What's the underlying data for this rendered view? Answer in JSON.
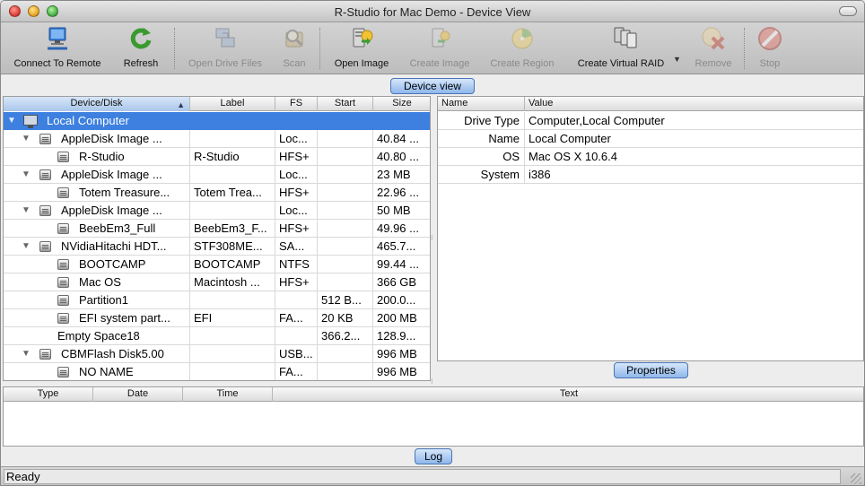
{
  "window": {
    "title": "R-Studio for Mac Demo - Device View"
  },
  "toolbar": {
    "items": [
      {
        "label": "Connect To Remote",
        "icon": "connect-remote-icon",
        "enabled": true
      },
      {
        "label": "Refresh",
        "icon": "refresh-icon",
        "enabled": true
      },
      {
        "label": "Open Drive Files",
        "icon": "open-drive-files-icon",
        "enabled": false
      },
      {
        "label": "Scan",
        "icon": "scan-icon",
        "enabled": false
      },
      {
        "label": "Open Image",
        "icon": "open-image-icon",
        "enabled": true
      },
      {
        "label": "Create Image",
        "icon": "create-image-icon",
        "enabled": false
      },
      {
        "label": "Create Region",
        "icon": "create-region-icon",
        "enabled": false
      },
      {
        "label": "Create Virtual RAID",
        "icon": "create-virtual-raid-icon",
        "enabled": true
      },
      {
        "label": "Remove",
        "icon": "remove-icon",
        "enabled": false
      },
      {
        "label": "Stop",
        "icon": "stop-icon",
        "enabled": false
      }
    ]
  },
  "device_view": {
    "button_label": "Device view",
    "columns": [
      "Device/Disk",
      "Label",
      "FS",
      "Start",
      "Size"
    ],
    "rows": [
      {
        "name": "Local Computer",
        "label": "",
        "fs": "",
        "start": "",
        "size": "",
        "level": 0,
        "expander": true,
        "icon": "computer-icon",
        "selected": true
      },
      {
        "name": "AppleDisk Image ...",
        "label": "",
        "fs": "Loc...",
        "start": "",
        "size": "40.84 ...",
        "level": 1,
        "expander": true,
        "icon": "disk-icon"
      },
      {
        "name": "R-Studio",
        "label": "R-Studio",
        "fs": "HFS+",
        "start": "",
        "size": "40.80 ...",
        "level": 2,
        "expander": false,
        "icon": "disk-icon"
      },
      {
        "name": "AppleDisk Image ...",
        "label": "",
        "fs": "Loc...",
        "start": "",
        "size": "23 MB",
        "level": 1,
        "expander": true,
        "icon": "disk-icon"
      },
      {
        "name": "Totem Treasure...",
        "label": "Totem Trea...",
        "fs": "HFS+",
        "start": "",
        "size": "22.96 ...",
        "level": 2,
        "expander": false,
        "icon": "disk-icon"
      },
      {
        "name": "AppleDisk Image ...",
        "label": "",
        "fs": "Loc...",
        "start": "",
        "size": "50 MB",
        "level": 1,
        "expander": true,
        "icon": "disk-icon"
      },
      {
        "name": "BeebEm3_Full",
        "label": "BeebEm3_F...",
        "fs": "HFS+",
        "start": "",
        "size": "49.96 ...",
        "level": 2,
        "expander": false,
        "icon": "disk-icon"
      },
      {
        "name": "NVidiaHitachi HDT...",
        "label": "STF308ME...",
        "fs": "SA...",
        "start": "",
        "size": "465.7...",
        "level": 1,
        "expander": true,
        "icon": "disk-icon"
      },
      {
        "name": "BOOTCAMP",
        "label": "BOOTCAMP",
        "fs": "NTFS",
        "start": "",
        "size": "99.44 ...",
        "level": 2,
        "expander": false,
        "icon": "disk-icon"
      },
      {
        "name": "Mac OS",
        "label": "Macintosh ...",
        "fs": "HFS+",
        "start": "",
        "size": "366 GB",
        "level": 2,
        "expander": false,
        "icon": "disk-icon"
      },
      {
        "name": "Partition1",
        "label": "",
        "fs": "",
        "start": "512 B...",
        "size": "200.0...",
        "level": 2,
        "expander": false,
        "icon": "disk-icon"
      },
      {
        "name": "EFI system part...",
        "label": "EFI",
        "fs": "FA...",
        "start": "20 KB",
        "size": "200 MB",
        "level": 2,
        "expander": false,
        "icon": "disk-icon"
      },
      {
        "name": "Empty Space18",
        "label": "",
        "fs": "",
        "start": "366.2...",
        "size": "128.9...",
        "level": 2,
        "expander": false,
        "icon": ""
      },
      {
        "name": "CBMFlash Disk5.00",
        "label": "",
        "fs": "USB...",
        "start": "",
        "size": "996 MB",
        "level": 1,
        "expander": true,
        "icon": "disk-icon"
      },
      {
        "name": "NO NAME",
        "label": "",
        "fs": "FA...",
        "start": "",
        "size": "996 MB",
        "level": 2,
        "expander": false,
        "icon": "disk-icon"
      }
    ]
  },
  "properties": {
    "button_label": "Properties",
    "columns": [
      "Name",
      "Value"
    ],
    "rows": [
      {
        "name": "Drive Type",
        "value": "Computer,Local Computer"
      },
      {
        "name": "Name",
        "value": "Local Computer"
      },
      {
        "name": "OS",
        "value": "Mac OS X 10.6.4"
      },
      {
        "name": "System",
        "value": "i386"
      }
    ]
  },
  "log": {
    "button_label": "Log",
    "columns": [
      "Type",
      "Date",
      "Time",
      "Text"
    ]
  },
  "status": {
    "text": "Ready"
  },
  "colors": {
    "selection": "#3d80df",
    "button_blue": "#8fb7ea"
  }
}
